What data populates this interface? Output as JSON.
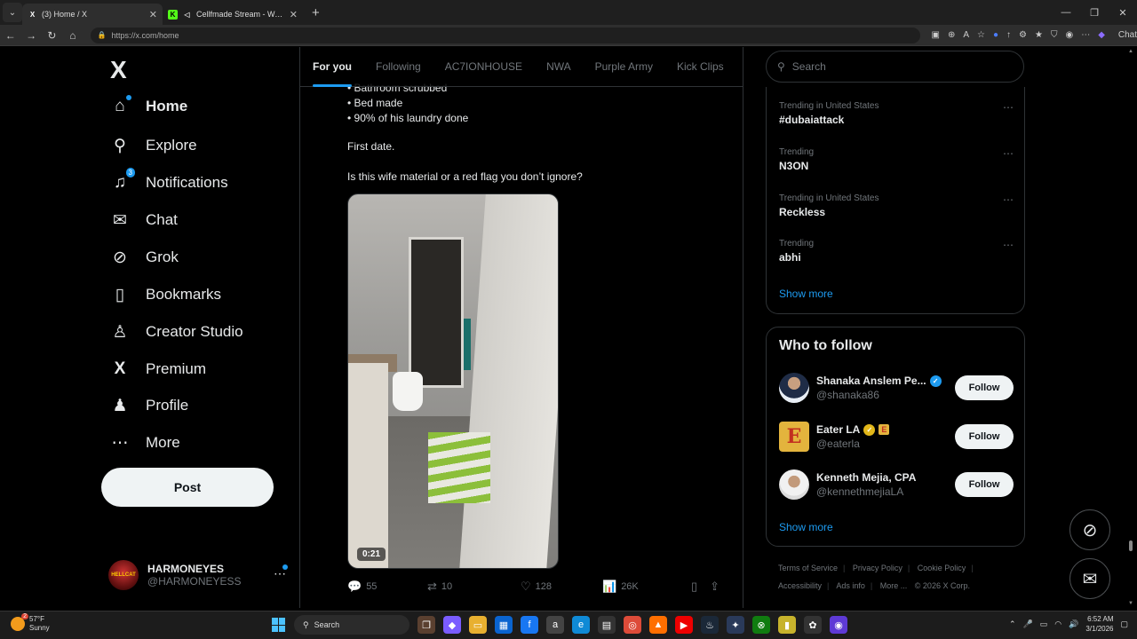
{
  "browser": {
    "tabs": [
      {
        "title": "(3) Home / X",
        "active": true,
        "favicon": "x-favicon"
      },
      {
        "title": "Cellfmade Stream - Watch Live",
        "active": false,
        "favicon": "kick-favicon"
      }
    ],
    "url": "https://x.com/home",
    "chat_label": "Chat"
  },
  "sidebar": {
    "logo": "X",
    "items": [
      {
        "label": "Home",
        "icon": "home-icon",
        "glyph": "⌂",
        "active": true
      },
      {
        "label": "Explore",
        "icon": "search-icon",
        "glyph": "⚲"
      },
      {
        "label": "Notifications",
        "icon": "bell-icon",
        "glyph": "🔔",
        "badge": "3"
      },
      {
        "label": "Chat",
        "icon": "mail-icon",
        "glyph": "✉"
      },
      {
        "label": "Grok",
        "icon": "grok-icon",
        "glyph": "⊘"
      },
      {
        "label": "Bookmarks",
        "icon": "bookmark-icon",
        "glyph": "🔖"
      },
      {
        "label": "Creator Studio",
        "icon": "creator-icon",
        "glyph": "♙"
      },
      {
        "label": "Premium",
        "icon": "x-premium-icon",
        "glyph": "X"
      },
      {
        "label": "Profile",
        "icon": "person-icon",
        "glyph": "👤"
      },
      {
        "label": "More",
        "icon": "more-circle-icon",
        "glyph": "⋯"
      }
    ],
    "post_label": "Post",
    "account": {
      "name": "HARMONEYES",
      "handle": "@HARMONEYESS",
      "avatar_text": "HELLCAT"
    }
  },
  "main": {
    "tabs": [
      "For you",
      "Following",
      "AC7IONHOUSE",
      "NWA",
      "Purple Army",
      "Kick Clips"
    ],
    "tweet": {
      "lines": [
        "• Bathroom scrubbed",
        "• Bed made",
        "• 90% of his laundry done"
      ],
      "line2": "First date.",
      "line3": "Is this wife material or a red flag you don’t ignore?",
      "video_duration": "0:21",
      "replies": "55",
      "reposts": "10",
      "likes": "128",
      "views": "26K"
    }
  },
  "right": {
    "search_placeholder": "Search",
    "trends": [
      {
        "context": "Trending in United States",
        "name": "#dubaiattack"
      },
      {
        "context": "Trending",
        "name": "N3ON"
      },
      {
        "context": "Trending in United States",
        "name": "Reckless"
      },
      {
        "context": "Trending",
        "name": "abhi"
      }
    ],
    "show_more": "Show more",
    "who_to_follow": {
      "title": "Who to follow",
      "accounts": [
        {
          "name": "Shanaka Anslem Pe...",
          "handle": "@shanaka86",
          "badge": "blue"
        },
        {
          "name": "Eater LA",
          "handle": "@eaterla",
          "badge": "gold",
          "affiliate": "E"
        },
        {
          "name": "Kenneth Mejia, CPA",
          "handle": "@kennethmejiaLA"
        }
      ],
      "follow_label": "Follow",
      "show_more": "Show more"
    },
    "footer": [
      "Terms of Service",
      "Privacy Policy",
      "Cookie Policy",
      "Accessibility",
      "Ads info",
      "More ...",
      "© 2026 X Corp."
    ]
  },
  "taskbar": {
    "temp": "57°F",
    "condition": "Sunny",
    "weather_badge": "2",
    "search_label": "Search",
    "time": "6:52 AM",
    "date": "3/1/2026"
  }
}
